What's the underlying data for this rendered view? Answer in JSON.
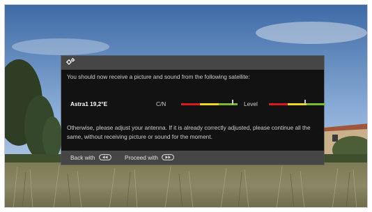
{
  "dialog": {
    "header_icon": "gears-icon",
    "message_intro": "You should now receive a picture and sound from the following satellite:",
    "satellite_name": "Astra1 19,2°E",
    "cn_label": "C/N",
    "level_label": "Level",
    "cn_level": 0.93,
    "signal_level": 0.65,
    "message_otherwise": "Otherwise, please adjust your antenna. If it is already correctly adjusted, please continue all the same, without receiving picture or sound for the moment.",
    "footer": {
      "back_label": "Back with",
      "back_icon": "rewind-button-icon",
      "proceed_label": "Proceed with",
      "proceed_icon": "fast-forward-button-icon"
    }
  },
  "colors": {
    "meter_red": "#d9191e",
    "meter_yellow": "#ecd824",
    "meter_green": "#7cbb2c"
  }
}
